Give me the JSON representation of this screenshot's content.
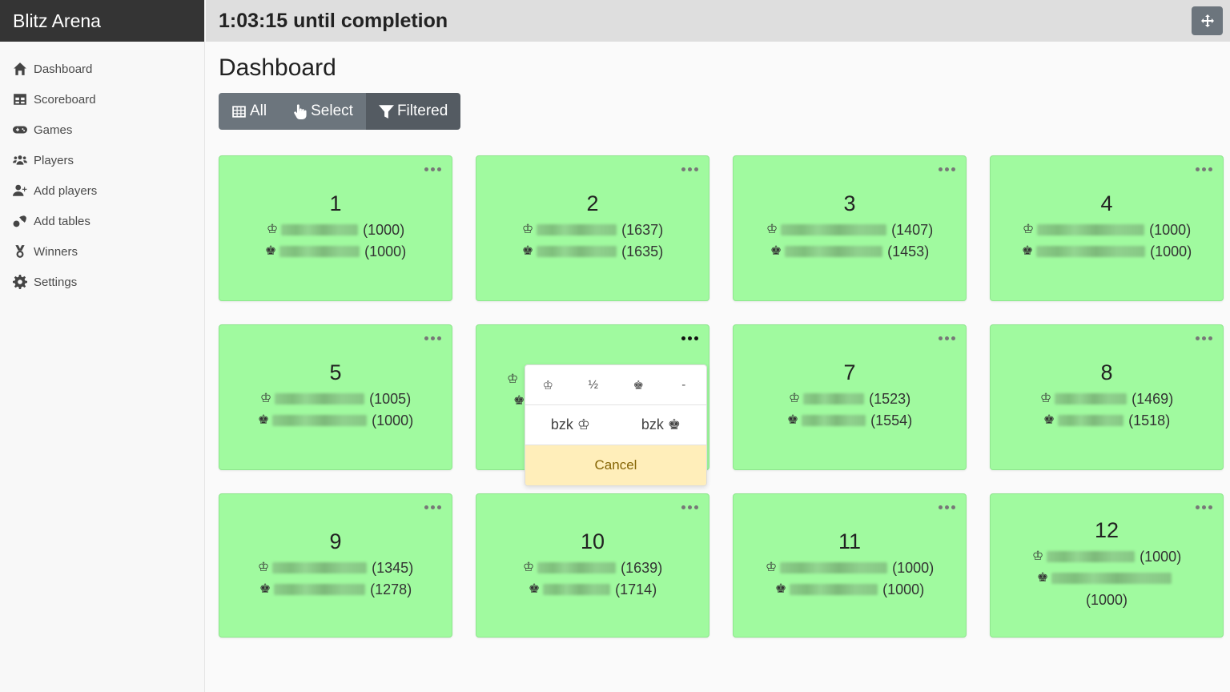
{
  "app": {
    "title": "Blitz Arena"
  },
  "topbar": {
    "countdown": "1:03:15 until completion",
    "move_icon": "arrows-move-icon"
  },
  "sidebar": {
    "items": [
      {
        "label": "Dashboard",
        "icon": "home-icon"
      },
      {
        "label": "Scoreboard",
        "icon": "table-icon"
      },
      {
        "label": "Games",
        "icon": "gamepad-icon"
      },
      {
        "label": "Players",
        "icon": "users-icon"
      },
      {
        "label": "Add players",
        "icon": "user-plus-icon"
      },
      {
        "label": "Add tables",
        "icon": "table-tennis-icon"
      },
      {
        "label": "Winners",
        "icon": "medal-icon"
      },
      {
        "label": "Settings",
        "icon": "gear-icon"
      }
    ]
  },
  "main": {
    "title": "Dashboard",
    "filters": [
      {
        "label": "All",
        "icon": "grid-icon",
        "active": false
      },
      {
        "label": "Select",
        "icon": "hand-pointer-icon",
        "active": false
      },
      {
        "label": "Filtered",
        "icon": "filter-icon",
        "active": true
      }
    ]
  },
  "symbols": {
    "white": "♔",
    "black": "♚"
  },
  "tables": [
    {
      "number": "1",
      "white_rating": "(1000)",
      "black_rating": "(1000)"
    },
    {
      "number": "2",
      "white_rating": "(1637)",
      "black_rating": "(1635)"
    },
    {
      "number": "3",
      "white_rating": "(1407)",
      "black_rating": "(1453)"
    },
    {
      "number": "4",
      "white_rating": "(1000)",
      "black_rating": "(1000)"
    },
    {
      "number": "5",
      "white_rating": "(1005)",
      "black_rating": "(1000)"
    },
    {
      "number": "",
      "white_rating": "",
      "black_rating": ""
    },
    {
      "number": "7",
      "white_rating": "(1523)",
      "black_rating": "(1554)"
    },
    {
      "number": "8",
      "white_rating": "(1469)",
      "black_rating": "(1518)"
    },
    {
      "number": "9",
      "white_rating": "(1345)",
      "black_rating": "(1278)"
    },
    {
      "number": "10",
      "white_rating": "(1639)",
      "black_rating": "(1714)"
    },
    {
      "number": "11",
      "white_rating": "(1000)",
      "black_rating": "(1000)"
    },
    {
      "number": "12",
      "white_rating": "(1000)",
      "black_rating": "(1000)"
    }
  ],
  "result_popup": {
    "options": [
      "♔",
      "½",
      "♚",
      "-"
    ],
    "forfeit_options": [
      "bzk ♔",
      "bzk ♚"
    ],
    "cancel_label": "Cancel"
  }
}
